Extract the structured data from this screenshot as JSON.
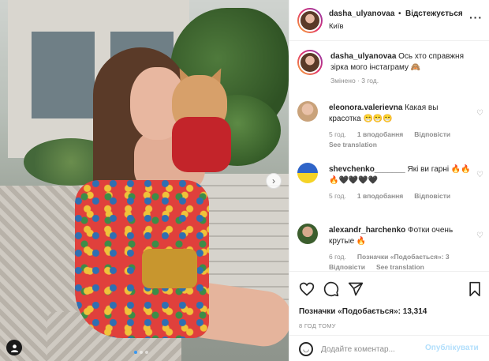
{
  "post": {
    "photo_alt": "",
    "carousel": {
      "dots": 3,
      "active": 0
    },
    "next_icon": "chevron-right-icon",
    "tag_icon": "user-icon"
  },
  "header": {
    "username": "dasha_ulyanovaa",
    "separator": "•",
    "follow_status": "Відстежується",
    "location": "Київ",
    "more": "···"
  },
  "caption": {
    "username": "dasha_ulyanovaa",
    "text": "Ось хто справжня зірка мого інстаграму 🙈",
    "meta": "Змінено · 3 год."
  },
  "comments": [
    {
      "username": "eleonora.valerievna",
      "text": "Какая вы красотка 😁😁😁",
      "time": "5 год.",
      "likes": "1 вподобання",
      "reply": "Відповісти",
      "translate": "See translation"
    },
    {
      "username": "shevchenko_______",
      "text": "Які ви гарні 🔥🔥🔥🖤🖤🖤🖤",
      "time": "5 год.",
      "likes": "1 вподобання",
      "reply": "Відповісти"
    },
    {
      "username": "alexandr_harchenko",
      "text": "Фотки очень крутые 🔥",
      "time": "6 год.",
      "likes": "Позначки «Подобається»: 3",
      "reply": "Відповісти",
      "translate": "See translation"
    }
  ],
  "actions": {
    "like_icon": "heart-icon",
    "comment_icon": "comment-icon",
    "share_icon": "send-icon",
    "save_icon": "bookmark-icon"
  },
  "stats": {
    "likes": "Позначки «Подобається»: 13,314",
    "time_ago": "8 ГОД ТОМУ"
  },
  "add_comment": {
    "placeholder": "Додайте коментар...",
    "publish": "Опублікувати"
  }
}
